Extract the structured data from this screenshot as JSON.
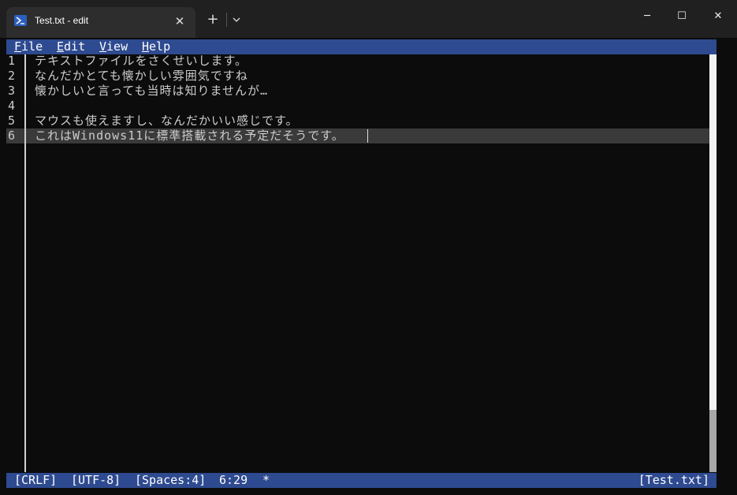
{
  "window": {
    "tab_title": "Test.txt - edit",
    "controls": {
      "minimize": "─",
      "maximize": "☐",
      "close": "✕"
    },
    "new_tab": "+",
    "tab_close": "✕"
  },
  "menu": {
    "items": [
      {
        "label": "File",
        "accelerator": "F",
        "rest": "ile"
      },
      {
        "label": "Edit",
        "accelerator": "E",
        "rest": "dit"
      },
      {
        "label": "View",
        "accelerator": "V",
        "rest": "iew"
      },
      {
        "label": "Help",
        "accelerator": "H",
        "rest": "elp"
      }
    ]
  },
  "editor": {
    "lines": [
      {
        "number": "1",
        "text": "テキストファイルをさくせいします。"
      },
      {
        "number": "2",
        "text": "なんだかとても懐かしい雰囲気ですね"
      },
      {
        "number": "3",
        "text": "懐かしいと言っても当時は知りませんが…"
      },
      {
        "number": "4",
        "text": ""
      },
      {
        "number": "5",
        "text": "マウスも使えますし、なんだかいい感じです。"
      },
      {
        "number": "6",
        "text": "これはWindows11に標準搭載される予定だそうです。"
      }
    ],
    "current_line": 6
  },
  "status": {
    "line_ending": "[CRLF]",
    "encoding": "[UTF-8]",
    "indent": "[Spaces:4]",
    "position": "6:29",
    "modified": "*",
    "filename": "[Test.txt]"
  }
}
